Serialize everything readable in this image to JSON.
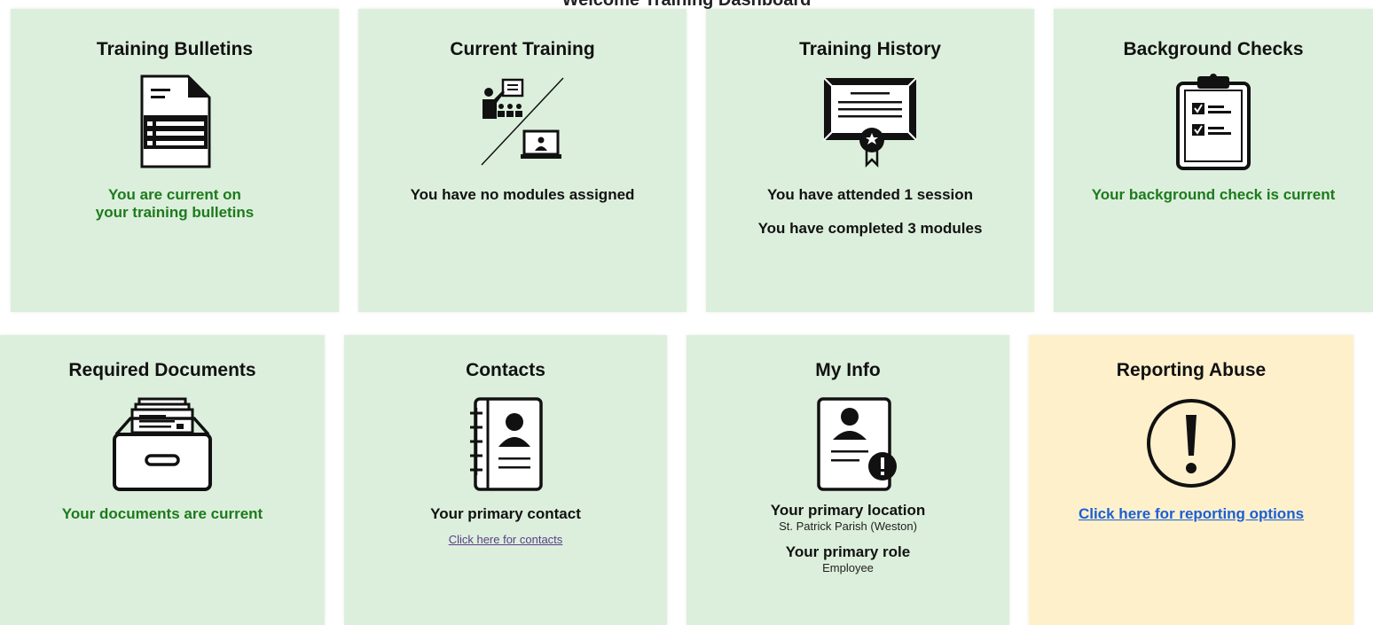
{
  "header": {
    "title": "Welcome Training Dashboard"
  },
  "tiles": {
    "training_bulletins": {
      "title": "Training Bulletins",
      "icon": "document-icon",
      "status_line1": "You are current on",
      "status_line2": "your training bulletins"
    },
    "current_training": {
      "title": "Current Training",
      "icon": "training-icon",
      "status": "You have no modules assigned"
    },
    "training_history": {
      "title": "Training History",
      "icon": "certificate-icon",
      "status_line1": "You have attended 1 session",
      "status_line2": "You have completed 3 modules"
    },
    "background_checks": {
      "title": "Background Checks",
      "icon": "clipboard-checklist-icon",
      "status": "Your background check is current"
    },
    "required_documents": {
      "title": "Required Documents",
      "icon": "file-drawer-icon",
      "status": "Your documents are current"
    },
    "contacts": {
      "title": "Contacts",
      "icon": "address-book-icon",
      "status": "Your primary contact",
      "link": "Click here for contacts"
    },
    "my_info": {
      "title": "My Info",
      "icon": "profile-alert-icon",
      "location_label": "Your primary location",
      "location_value": "St. Patrick Parish (Weston)",
      "role_label": "Your primary role",
      "role_value": "Employee"
    },
    "reporting_abuse": {
      "title": "Reporting Abuse",
      "icon": "exclamation-circle-icon",
      "link": "Click here for reporting options"
    }
  },
  "colors": {
    "tile_green": "#dcefdc",
    "tile_yellow": "#fff0cc",
    "status_green": "#1d7a1d",
    "link_blue": "#1a5fd6"
  }
}
